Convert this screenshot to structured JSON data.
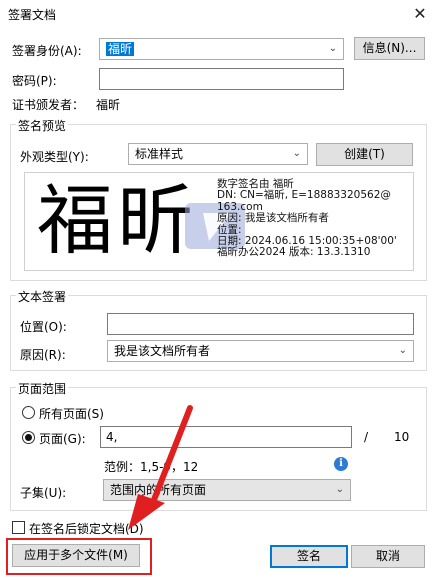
{
  "window": {
    "title": "签署文档",
    "close": "✕"
  },
  "identity": {
    "label": "签署身份(A):",
    "value": "福昕",
    "info_button": "信息(N)..."
  },
  "password": {
    "label": "密码(P):",
    "value": ""
  },
  "issuer": {
    "label": "证书颁发者：",
    "value": "福昕"
  },
  "preview": {
    "group_title": "签名预览",
    "appearance_label": "外观类型(Y):",
    "appearance_value": "标准样式",
    "create_button": "创建(T)",
    "signer_name_big": "福昕",
    "lines": [
      "数字签名由 福昕",
      "DN:  CN=福昕, E=18883320562@",
      "163.com",
      "原因:  我是该文档所有者",
      "位置:",
      "日期:   2024.06.16 15:00:35+08'00'",
      "福昕办公2024 版本: 13.3.1310"
    ]
  },
  "text_signature": {
    "group_title": "文本签署",
    "location_label": "位置(O):",
    "location_value": "",
    "reason_label": "原因(R):",
    "reason_value": "我是该文档所有者"
  },
  "page_range": {
    "group_title": "页面范围",
    "all_pages": "所有页面(S)",
    "pages": "页面(G):",
    "pages_value": "4,",
    "separator": "/",
    "total": "10",
    "example": "范例：1,5-9，12",
    "subset_label": "子集(U):",
    "subset_value": "范围内的所有页面"
  },
  "lock": {
    "label": "在签名后锁定文档(D)",
    "checked": false
  },
  "buttons": {
    "apply_multiple": "应用于多个文件(M)",
    "sign": "签名",
    "cancel": "取消"
  },
  "colors": {
    "accent": "#0078d7",
    "annotation_red": "#e02020",
    "info_blue": "#2e7bd6"
  }
}
